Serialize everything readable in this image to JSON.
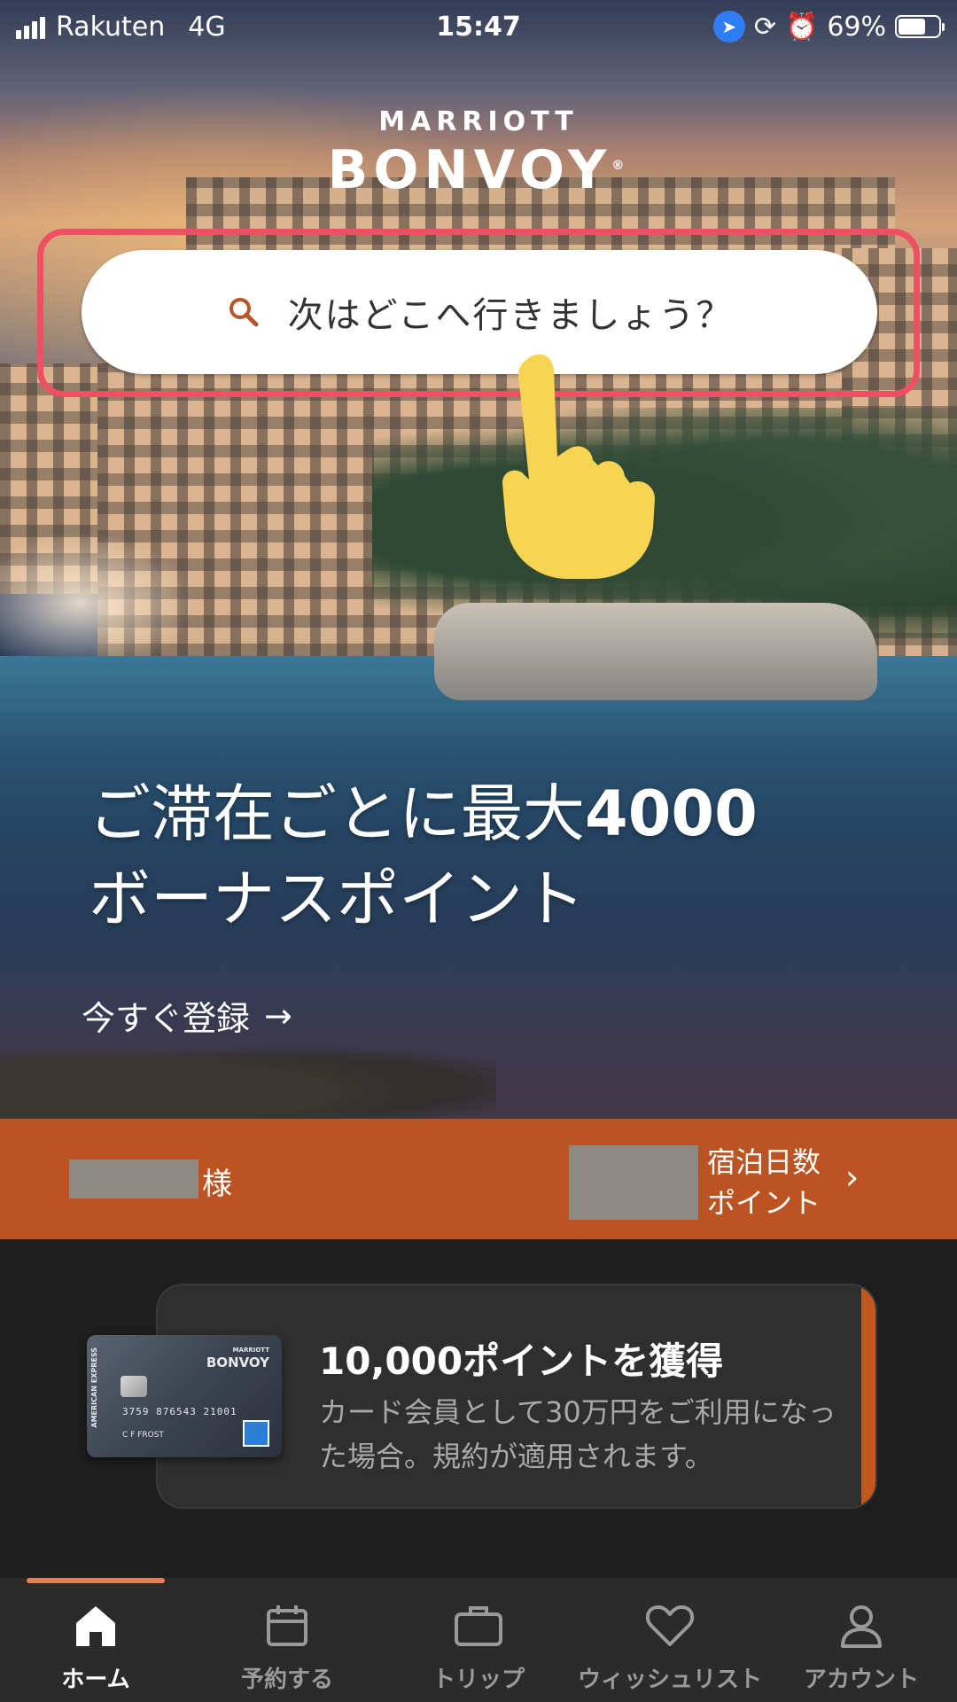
{
  "status_bar": {
    "carrier": "Rakuten",
    "network": "4G",
    "time": "15:47",
    "battery": "69%",
    "battery_level": 0.69
  },
  "logo": {
    "top": "MARRIOTT",
    "main": "BONVOY",
    "reg": "®"
  },
  "search": {
    "placeholder": "次はどこへ行きましょう？"
  },
  "hero": {
    "headline_line1": "ご滞在ごとに最大",
    "headline_number": "4000",
    "headline_line2": "ボーナスポイント",
    "cta": "今すぐ登録",
    "cta_arrow": "→"
  },
  "member": {
    "honorific": "様",
    "stat_label_1": "宿泊日数",
    "stat_label_2": "ポイント",
    "chevron": "›"
  },
  "promo": {
    "title": "10,000ポイントを獲得",
    "body": "カード会員として30万円をご利用になった場合。規約が適用されます。",
    "card": {
      "brand_top": "MARRIOTT",
      "brand_main": "BONVOY",
      "number": "3759 876543 21001",
      "holder": "C F FROST",
      "issuer": "AMERICAN EXPRESS"
    }
  },
  "tabs": [
    {
      "label": "ホーム",
      "icon": "home-icon",
      "active": true
    },
    {
      "label": "予約する",
      "icon": "calendar-icon",
      "active": false
    },
    {
      "label": "トリップ",
      "icon": "briefcase-icon",
      "active": false
    },
    {
      "label": "ウィッシュリスト",
      "icon": "heart-icon",
      "active": false
    },
    {
      "label": "アカウント",
      "icon": "person-icon",
      "active": false
    }
  ],
  "colors": {
    "accent_orange": "#bb5422",
    "highlight_red": "#ee4f63",
    "pointer_yellow": "#f7d452",
    "tab_bar": "#2b2b2b"
  }
}
